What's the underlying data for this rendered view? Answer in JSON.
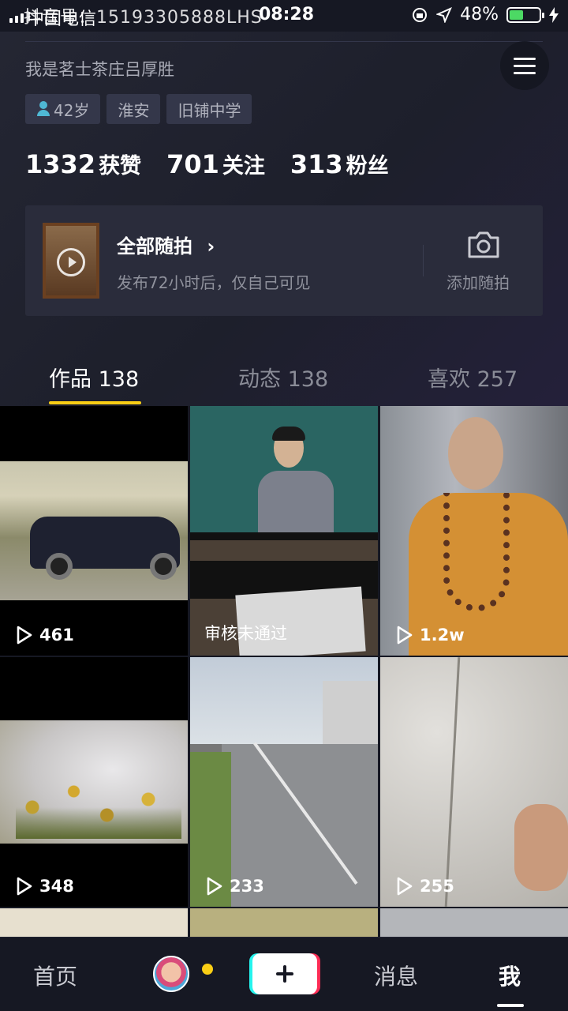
{
  "status_bar": {
    "carrier": "中国电信",
    "overlay_text": "抖音号：15193305888LHS",
    "time": "08:28",
    "battery": "48%",
    "battery_level": 0.48
  },
  "profile": {
    "signature": "我是茗士茶庄吕厚胜",
    "tags": [
      "42岁",
      "淮安",
      "旧铺中学"
    ],
    "stats": [
      {
        "value": "1332",
        "label": "获赞"
      },
      {
        "value": "701",
        "label": "关注"
      },
      {
        "value": "313",
        "label": "粉丝"
      }
    ]
  },
  "suipai": {
    "title": "全部随拍",
    "chevron": "›",
    "subtitle": "发布72小时后，仅自己可见",
    "add_label": "添加随拍",
    "icons": {
      "camera": "camera-icon",
      "arrow": "chevron-right-icon"
    }
  },
  "tabs": [
    {
      "label": "作品 138",
      "active": true
    },
    {
      "label": "动态 138",
      "active": false
    },
    {
      "label": "喜欢 257",
      "active": false
    }
  ],
  "videos": [
    {
      "count": "461",
      "status": ""
    },
    {
      "count": "",
      "status": "审核未通过"
    },
    {
      "count": "1.2w",
      "status": ""
    },
    {
      "count": "348",
      "status": ""
    },
    {
      "count": "233",
      "status": ""
    },
    {
      "count": "255",
      "status": ""
    }
  ],
  "bottom_nav": {
    "home": "首页",
    "messages": "消息",
    "me": "我"
  },
  "colors": {
    "accent": "#face15",
    "background": "#161823",
    "tiktok_cyan": "#25f4ee",
    "tiktok_red": "#fe2c55"
  }
}
